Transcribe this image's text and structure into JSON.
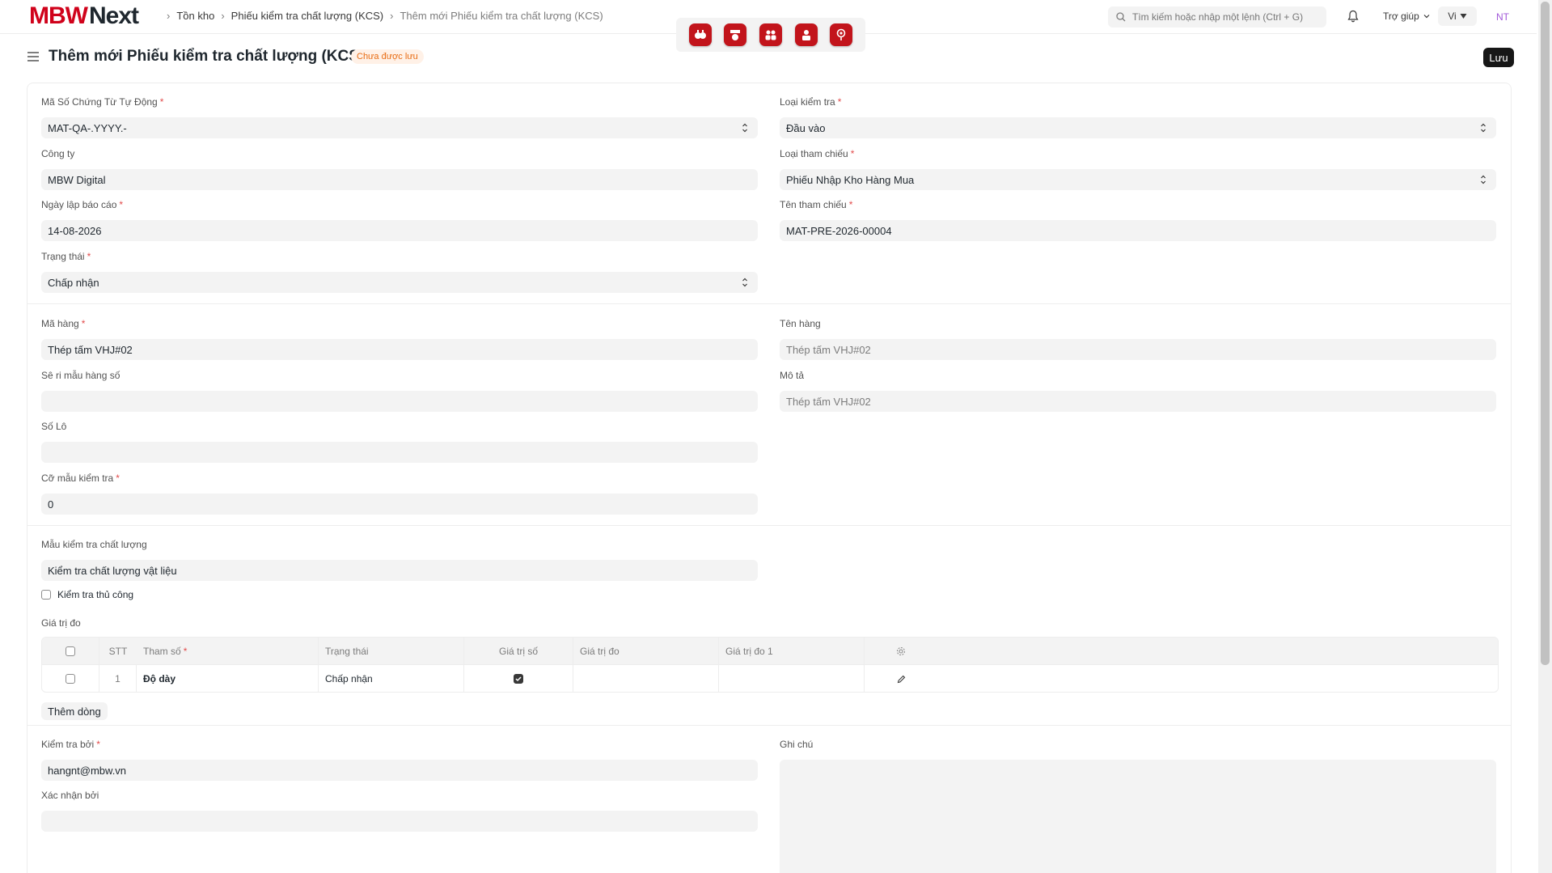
{
  "nav": {
    "logo_mbw": "MBW",
    "logo_next": "Next",
    "breadcrumbs": [
      "Tồn kho",
      "Phiếu kiểm tra chất lượng (KCS)",
      "Thêm mới Phiếu kiểm tra chất lượng (KCS)"
    ],
    "search_placeholder": "Tìm kiếm hoặc nhập một lệnh (Ctrl + G)",
    "help_label": "Trợ giúp",
    "lang_label": "Vi",
    "avatar_initials": "NT",
    "quick_apps": [
      "app-sales-icon",
      "app-inventory-icon",
      "app-team-icon",
      "app-employee-icon",
      "app-location-icon"
    ]
  },
  "page": {
    "title": "Thêm mới Phiếu kiểm tra chất lượng (KCS)",
    "status_badge": "Chưa được lưu",
    "save_label": "Lưu"
  },
  "form": {
    "naming_series": {
      "label": "Mã Số Chứng Từ Tự Động",
      "value": "MAT-QA-.YYYY.-"
    },
    "inspection_type": {
      "label": "Loại kiểm tra",
      "value": "Đầu vào"
    },
    "company": {
      "label": "Công ty",
      "value": "MBW Digital"
    },
    "reference_type": {
      "label": "Loại tham chiếu",
      "value": "Phiếu Nhập Kho Hàng Mua"
    },
    "report_date": {
      "label": "Ngày lập báo cáo",
      "value": "14-08-2026"
    },
    "reference_name": {
      "label": "Tên tham chiếu",
      "value": "MAT-PRE-2026-00004"
    },
    "status": {
      "label": "Trạng thái",
      "value": "Chấp nhận"
    },
    "item_code": {
      "label": "Mã hàng",
      "value": "Thép tấm VHJ#02"
    },
    "item_name": {
      "label": "Tên hàng",
      "value": "Thép tấm VHJ#02"
    },
    "serial_no": {
      "label": "Sê ri mẫu hàng số",
      "value": ""
    },
    "description": {
      "label": "Mô tả",
      "value": "Thép tấm VHJ#02"
    },
    "batch_no": {
      "label": "Số Lô",
      "value": ""
    },
    "sample_size": {
      "label": "Cỡ mẫu kiểm tra",
      "value": "0"
    },
    "template": {
      "label": "Mẫu kiểm tra chất lượng",
      "value": "Kiểm tra chất lượng vật liệu"
    },
    "manual_inspection": {
      "label": "Kiểm tra thủ công",
      "checked": false
    },
    "readings_label": "Giá trị đo",
    "readings_columns": [
      "STT",
      "Tham số",
      "Trạng thái",
      "Giá trị số",
      "Giá trị đo",
      "Giá trị đo 1"
    ],
    "readings_rows": [
      {
        "idx": "1",
        "parameter": "Độ dày",
        "status": "Chấp nhận",
        "numeric": true,
        "reading": "",
        "reading_1": ""
      }
    ],
    "add_row_label": "Thêm dòng",
    "inspected_by": {
      "label": "Kiểm tra bởi",
      "value": "hangnt@mbw.vn"
    },
    "remarks": {
      "label": "Ghi chú",
      "value": ""
    },
    "verified_by": {
      "label": "Xác nhận bởi",
      "value": ""
    }
  },
  "colors": {
    "brand_red": "#d0021b",
    "app_icon_red": "#c2141b",
    "badge_orange": "#e86c13",
    "required_red": "#e24c4c"
  }
}
